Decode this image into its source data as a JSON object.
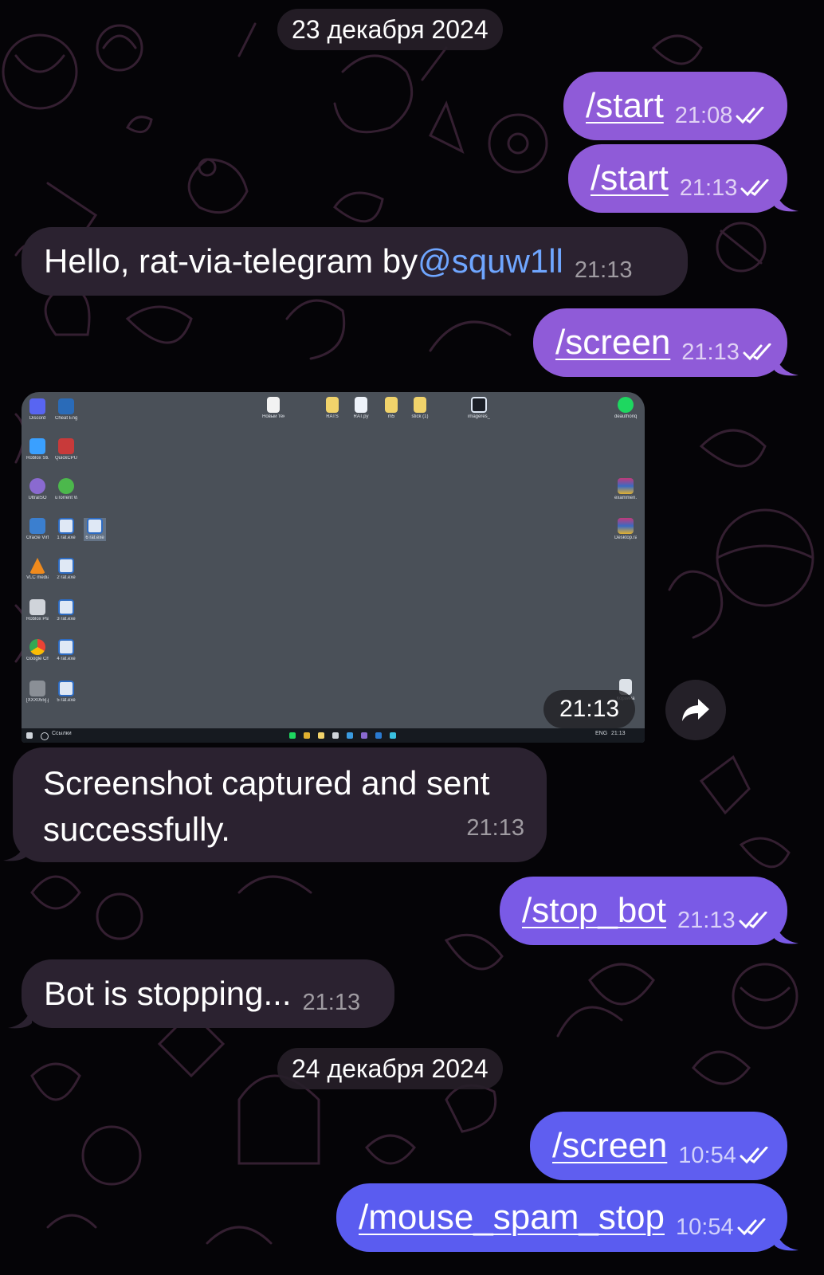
{
  "dates": [
    "23 декабря 2024",
    "24 декабря 2024"
  ],
  "messages": [
    {
      "cmd": "/start",
      "time": "21:08"
    },
    {
      "cmd": "/start",
      "time": "21:13"
    },
    {
      "pre": "Hello, rat-via-telegram by ",
      "mention": "@squw1ll",
      "time": "21:13"
    },
    {
      "cmd": "/screen",
      "time": "21:13"
    },
    {
      "time": "21:13"
    },
    {
      "text": "Screenshot captured and sent successfully.",
      "time": "21:13"
    },
    {
      "cmd": "/stop_bot",
      "time": "21:13"
    },
    {
      "text": "Bot is stopping...",
      "time": "21:13"
    },
    {
      "cmd": "/screen",
      "time": "10:54"
    },
    {
      "cmd": "/mouse_spam_stop",
      "time": "10:54"
    }
  ],
  "desktop": {
    "left_icons": [
      "Discord",
      "Cheat Engine",
      "Roblox Studio",
      "QuickCPU",
      "UltraISO",
      "uTorrent Web",
      "Oracle VirtualBox",
      "1 rat.exe",
      "6 rat.exe",
      "VLC media player",
      "2 rat.exe",
      "Roblox Player",
      "3 rat.exe",
      "Google Chrome",
      "4 rat.exe",
      "[XXX055].jpg",
      "5 rat.exe"
    ],
    "top_icons": [
      "Новый текстовый ...",
      "RATS",
      "RAT.py",
      "m5",
      "stick (1)",
      "imageres_1..."
    ],
    "right_icons": [
      "deauthoriq...",
      "exammen.rar",
      "Desktop.rar",
      "Корзина"
    ],
    "taskbar_search": "Ссылки",
    "taskbar_lang": "ENG",
    "taskbar_time": "21:13"
  },
  "colors": {
    "outgoing_violet": "#8f5bd8",
    "outgoing_blue": "#5a5cf0",
    "incoming": "#2b2230",
    "mention": "#6fa6ff",
    "background": "#050407"
  },
  "icons": [
    "double-check-icon",
    "forward-arrow-icon"
  ]
}
